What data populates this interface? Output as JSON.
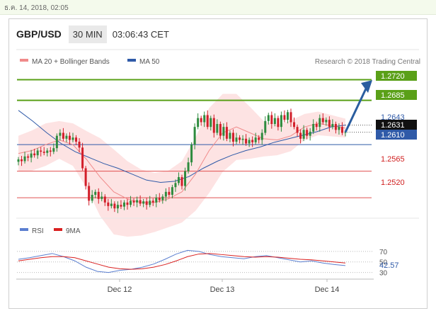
{
  "topbar": {
    "timestamp": "ธ.ค. 14, 2018, 02:05"
  },
  "header": {
    "symbol": "GBP/USD",
    "timeframe": "30 MIN",
    "time": "03:06:43 CET"
  },
  "legend": {
    "ma20_label": "MA 20 + Bollinger Bands",
    "ma50_label": "MA 50"
  },
  "credit": "Research © 2018 Trading Central",
  "colors": {
    "up": "#2e8b3e",
    "down": "#d21f2a",
    "ma50": "#2f5aa8",
    "ma20": "#f08a8a",
    "band": "#fde0e0",
    "target": "#5aa018",
    "support": "#2f5aa8",
    "resistance_red": "#e05050",
    "arrow": "#2a5d9f",
    "rsi": "#5b7fd0",
    "rsi_ma": "#d92020"
  },
  "levels": [
    {
      "label": "1.2720",
      "value": 1.272,
      "style": "target"
    },
    {
      "label": "1.2685",
      "value": 1.2685,
      "style": "target"
    },
    {
      "label": "1.2643",
      "value": 1.2643,
      "style": "price"
    },
    {
      "label": "1.2631",
      "value": 1.2631,
      "style": "current"
    },
    {
      "label": "1.2610",
      "value": 1.261,
      "style": "pivot"
    },
    {
      "label": "1.2565",
      "value": 1.2565,
      "style": "support"
    },
    {
      "label": "1.2520",
      "value": 1.252,
      "style": "support"
    }
  ],
  "rsi_panel": {
    "rsi_label": "RSI",
    "ma_label": "9MA",
    "ticks": [
      "70",
      "50",
      "30"
    ],
    "current": "42.57"
  },
  "chart_data": {
    "type": "line",
    "title": "GBP/USD",
    "x_tick_labels": [
      "Dec 12",
      "Dec 13",
      "Dec 14"
    ],
    "ylim": [
      1.2495,
      1.2735
    ],
    "series": [
      {
        "name": "GBP/USD",
        "values": [
          1.2585,
          1.2582,
          1.259,
          1.2588,
          1.2595,
          1.2592,
          1.26,
          1.2598,
          1.2596,
          1.26,
          1.2598,
          1.2604,
          1.2625,
          1.263,
          1.262,
          1.2625,
          1.2618,
          1.2622,
          1.2615,
          1.2605,
          1.257,
          1.254,
          1.2515,
          1.2525,
          1.253,
          1.2518,
          1.2522,
          1.2512,
          1.2506,
          1.251,
          1.2502,
          1.2508,
          1.2505,
          1.2512,
          1.2508,
          1.2515,
          1.2512,
          1.2516,
          1.251,
          1.2514,
          1.2508,
          1.2515,
          1.2512,
          1.252,
          1.2516,
          1.2522,
          1.253,
          1.2525,
          1.2538,
          1.2545,
          1.2555,
          1.254,
          1.2565,
          1.258,
          1.261,
          1.264,
          1.2655,
          1.2648,
          1.266,
          1.264,
          1.2655,
          1.263,
          1.2645,
          1.2625,
          1.264,
          1.262,
          1.263,
          1.2615,
          1.2622,
          1.2618,
          1.262,
          1.2612,
          1.2618,
          1.2614,
          1.2622,
          1.2618,
          1.263,
          1.265,
          1.266,
          1.2645,
          1.2655,
          1.264,
          1.266,
          1.2652,
          1.2665,
          1.2648,
          1.264,
          1.263,
          1.262,
          1.2635,
          1.2625,
          1.2632,
          1.2645,
          1.264,
          1.2655,
          1.2648,
          1.2652,
          1.264,
          1.2645,
          1.2635,
          1.264,
          1.263,
          1.2631
        ]
      },
      {
        "name": "MA 50",
        "values": [
          1.2668,
          1.265,
          1.263,
          1.2612,
          1.2598,
          1.2588,
          1.2578,
          1.257,
          1.256,
          1.255,
          1.2546,
          1.2548,
          1.2556,
          1.257,
          1.2582,
          1.2592,
          1.26,
          1.2606,
          1.2614,
          1.262,
          1.2626,
          1.2632,
          1.264,
          1.2643
        ]
      },
      {
        "name": "MA 20",
        "values": [
          1.2595,
          1.26,
          1.261,
          1.2618,
          1.261,
          1.2585,
          1.2555,
          1.253,
          1.2518,
          1.2512,
          1.2512,
          1.2518,
          1.253,
          1.256,
          1.26,
          1.263,
          1.264,
          1.263,
          1.262,
          1.2618,
          1.2625,
          1.264,
          1.2646,
          1.2642,
          1.2638
        ]
      }
    ],
    "rsi": [
      55,
      58,
      62,
      66,
      60,
      52,
      40,
      32,
      30,
      34,
      36,
      40,
      46,
      55,
      65,
      72,
      70,
      64,
      60,
      58,
      56,
      60,
      62,
      58,
      54,
      50,
      52,
      48,
      45,
      43
    ],
    "rsi_9ma": [
      52,
      55,
      58,
      60,
      60,
      58,
      52,
      46,
      40,
      37,
      36,
      37,
      40,
      45,
      52,
      60,
      65,
      66,
      64,
      62,
      60,
      59,
      60,
      59,
      57,
      55,
      54,
      52,
      50,
      48
    ]
  }
}
